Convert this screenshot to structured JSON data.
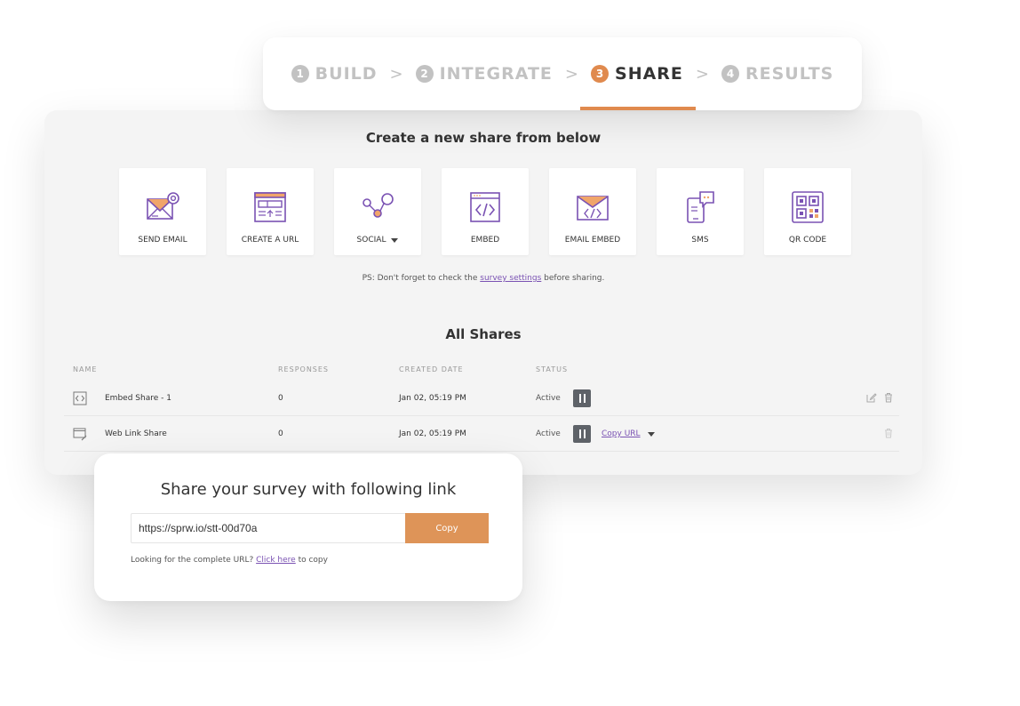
{
  "steps": [
    {
      "num": "1",
      "label": "BUILD",
      "active": false
    },
    {
      "num": "2",
      "label": "INTEGRATE",
      "active": false
    },
    {
      "num": "3",
      "label": "SHARE",
      "active": true
    },
    {
      "num": "4",
      "label": "RESULTS",
      "active": false
    }
  ],
  "main": {
    "title": "Create a new share from below",
    "tiles": [
      {
        "label": "SEND EMAIL",
        "icon": "envelope-at-icon"
      },
      {
        "label": "CREATE A URL",
        "icon": "browser-url-icon"
      },
      {
        "label": "SOCIAL",
        "icon": "share-nodes-icon",
        "dropdown": true
      },
      {
        "label": "EMBED",
        "icon": "code-window-icon"
      },
      {
        "label": "EMAIL EMBED",
        "icon": "envelope-code-icon"
      },
      {
        "label": "SMS",
        "icon": "phone-chat-icon"
      },
      {
        "label": "QR CODE",
        "icon": "qr-code-icon"
      }
    ],
    "ps_prefix": "PS: Don't forget to check the ",
    "ps_link": "survey settings",
    "ps_suffix": " before sharing."
  },
  "shares": {
    "title": "All Shares",
    "columns": {
      "name": "NAME",
      "responses": "RESPONSES",
      "created": "CREATED DATE",
      "status": "STATUS"
    },
    "rows": [
      {
        "name": "Embed Share - 1",
        "responses": "0",
        "created": "Jan 02, 05:19 PM",
        "status": "Active"
      },
      {
        "name": "Web Link Share",
        "responses": "0",
        "created": "Jan 02, 05:19 PM",
        "status": "Active",
        "copy_label": "Copy URL"
      }
    ]
  },
  "popup": {
    "title": "Share your survey with following link",
    "link": "https://sprw.io/stt-00d70a",
    "copy_label": "Copy",
    "note_prefix": "Looking for the complete URL? ",
    "note_link": "Click here",
    "note_suffix": " to copy"
  },
  "colors": {
    "accent": "#e08a4e",
    "icon_purple": "#7a52b3",
    "link": "#7a52b3"
  }
}
